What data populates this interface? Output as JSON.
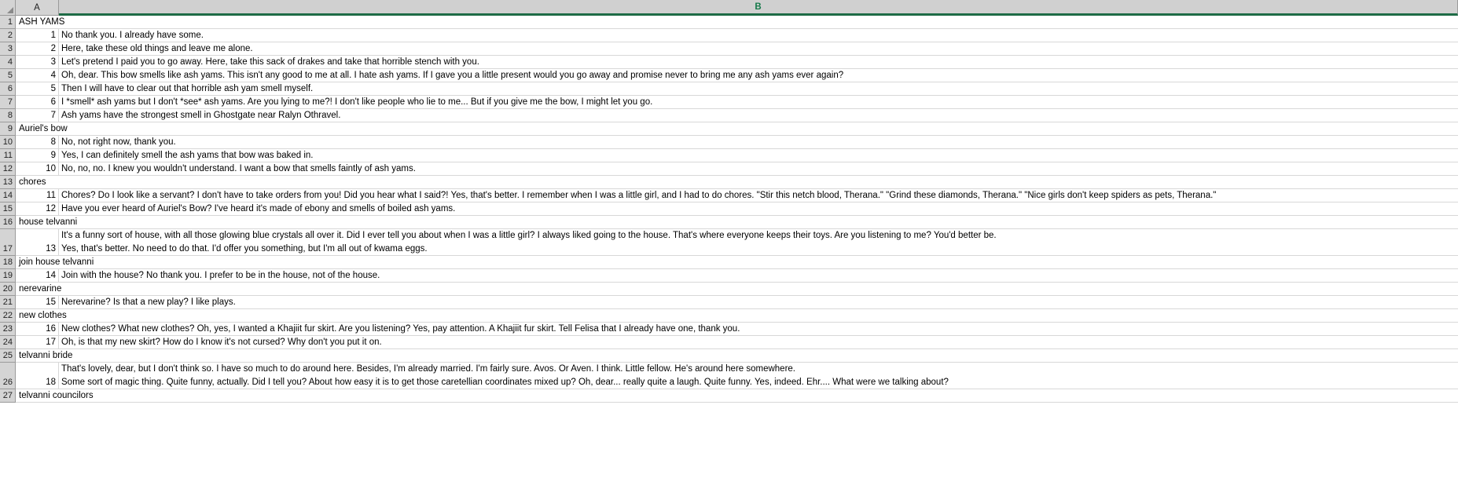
{
  "app": {
    "type": "spreadsheet",
    "selected_column": "B",
    "accent_color": "#1d6b45",
    "header_bg": "#d4d4d4",
    "gridline_color": "#d8d8d8"
  },
  "columns": {
    "corner_icon": "select-all-triangle-icon",
    "headers": [
      "A",
      "B"
    ]
  },
  "rows": [
    {
      "n": "1",
      "kind": "topic",
      "a": "ASH YAMS",
      "b": ""
    },
    {
      "n": "2",
      "kind": "entry",
      "a": "1",
      "b": "No thank you. I already have some."
    },
    {
      "n": "3",
      "kind": "entry",
      "a": "2",
      "b": "Here, take these old things and leave me alone."
    },
    {
      "n": "4",
      "kind": "entry",
      "a": "3",
      "b": "Let's pretend I paid you to go away. Here, take this sack of drakes and take that horrible stench with you."
    },
    {
      "n": "5",
      "kind": "entry",
      "a": "4",
      "b": "Oh, dear. This bow smells like ash yams. This isn't any good to me at all. I hate ash yams. If I gave you a little present would you go away and promise never to bring me any ash yams ever again?"
    },
    {
      "n": "6",
      "kind": "entry",
      "a": "5",
      "b": "Then I will have to clear out that horrible ash yam smell myself."
    },
    {
      "n": "7",
      "kind": "entry",
      "a": "6",
      "b": "I *smell* ash yams but I don't *see* ash yams. Are you lying to me?! I don't like people who lie to me... But if you give me the bow, I might let you go."
    },
    {
      "n": "8",
      "kind": "entry",
      "a": "7",
      "b": "Ash yams have the strongest smell in Ghostgate near Ralyn Othravel."
    },
    {
      "n": "9",
      "kind": "topic",
      "a": "Auriel's bow",
      "b": ""
    },
    {
      "n": "10",
      "kind": "entry",
      "a": "8",
      "b": "No, not right now, thank you."
    },
    {
      "n": "11",
      "kind": "entry",
      "a": "9",
      "b": "Yes, I can definitely smell the ash yams that bow was baked in."
    },
    {
      "n": "12",
      "kind": "entry",
      "a": "10",
      "b": "No, no, no. I knew you wouldn't understand. I want a bow that smells faintly of ash yams."
    },
    {
      "n": "13",
      "kind": "topic",
      "a": "chores",
      "b": ""
    },
    {
      "n": "14",
      "kind": "entry",
      "a": "11",
      "b": "Chores? Do I look like a servant? I don't have to take orders from you! Did you hear what I said?! Yes, that's better. I remember when I was a little girl, and I had to do chores. \"Stir this netch blood, Therana.\" \"Grind these diamonds, Therana.\" \"Nice girls don't keep spiders as pets, Therana.\""
    },
    {
      "n": "15",
      "kind": "entry",
      "a": "12",
      "b": "Have you ever heard of Auriel's Bow? I've heard it's made of ebony and smells of boiled ash yams."
    },
    {
      "n": "16",
      "kind": "topic",
      "a": "house telvanni",
      "b": ""
    },
    {
      "n": "17",
      "kind": "tall",
      "a": "",
      "b_lines": [
        "It's a funny sort of house, with all those glowing blue crystals all over it. Did I ever tell you about when I was a little girl? I always liked going to the house. That's where everyone keeps their toys. Are you listening to me? You'd better be."
      ],
      "label": "16-overflow"
    },
    {
      "n": "17b",
      "kind": "entry",
      "a": "13",
      "b": "Yes, that's better. No need to do that. I'd offer you something, but I'm all out of kwama eggs."
    },
    {
      "n": "18",
      "kind": "topic",
      "a": "join house telvanni",
      "b": ""
    },
    {
      "n": "19",
      "kind": "entry",
      "a": "14",
      "b": "Join with the house? No thank you. I prefer to be in the house, not of the house."
    },
    {
      "n": "20",
      "kind": "topic",
      "a": "nerevarine",
      "b": ""
    },
    {
      "n": "21",
      "kind": "entry",
      "a": "15",
      "b": "Nerevarine? Is that a new play? I like plays."
    },
    {
      "n": "22",
      "kind": "topic",
      "a": "new clothes",
      "b": ""
    },
    {
      "n": "23",
      "kind": "entry",
      "a": "16",
      "b": "New clothes? What new clothes? Oh, yes, I wanted a Khajiit fur skirt. Are you listening? Yes, pay attention. A Khajiit fur skirt. Tell Felisa that I already have one, thank you."
    },
    {
      "n": "24",
      "kind": "entry",
      "a": "17",
      "b": "Oh, is that my new skirt? How do I know it's not cursed? Why don't you put it on."
    },
    {
      "n": "25",
      "kind": "topic",
      "a": "telvanni bride",
      "b": ""
    },
    {
      "n": "26",
      "kind": "tall2",
      "a": "18",
      "b_line1": "That's lovely, dear, but I don't think so. I have so much to do around here. Besides, I'm already married. I'm fairly sure. Avos. Or Aven. I think. Little fellow. He's around here somewhere.",
      "b_line2": "Some sort of magic thing. Quite funny, actually. Did I tell you? About how easy it is to get those caretellian coordinates mixed up? Oh, dear... really quite a laugh. Quite funny. Yes, indeed. Ehr.... What were we talking about?"
    },
    {
      "n": "27",
      "kind": "topic",
      "a": "telvanni councilors",
      "b": ""
    }
  ]
}
